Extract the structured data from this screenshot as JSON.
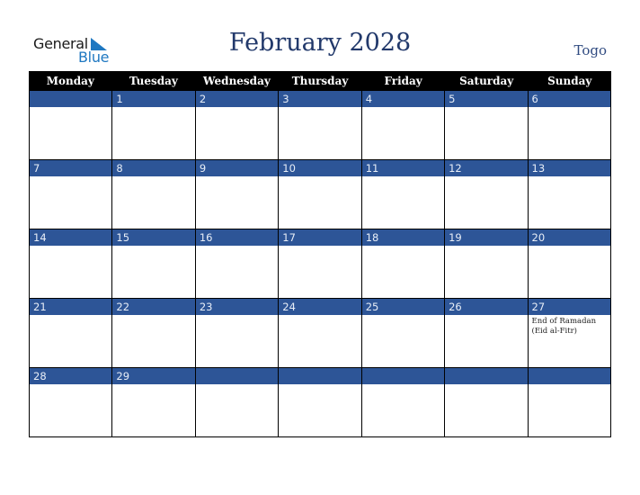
{
  "logo": {
    "line1": "General",
    "line2": "Blue"
  },
  "title": "February 2028",
  "country": "Togo",
  "weekdays": [
    "Monday",
    "Tuesday",
    "Wednesday",
    "Thursday",
    "Friday",
    "Saturday",
    "Sunday"
  ],
  "weeks": [
    [
      {
        "d": ""
      },
      {
        "d": "1"
      },
      {
        "d": "2"
      },
      {
        "d": "3"
      },
      {
        "d": "4"
      },
      {
        "d": "5"
      },
      {
        "d": "6"
      }
    ],
    [
      {
        "d": "7"
      },
      {
        "d": "8"
      },
      {
        "d": "9"
      },
      {
        "d": "10"
      },
      {
        "d": "11"
      },
      {
        "d": "12"
      },
      {
        "d": "13"
      }
    ],
    [
      {
        "d": "14"
      },
      {
        "d": "15"
      },
      {
        "d": "16"
      },
      {
        "d": "17"
      },
      {
        "d": "18"
      },
      {
        "d": "19"
      },
      {
        "d": "20"
      }
    ],
    [
      {
        "d": "21"
      },
      {
        "d": "22"
      },
      {
        "d": "23"
      },
      {
        "d": "24"
      },
      {
        "d": "25"
      },
      {
        "d": "26"
      },
      {
        "d": "27",
        "event": "End of Ramadan (Eid al-Fitr)"
      }
    ],
    [
      {
        "d": "28"
      },
      {
        "d": "29"
      },
      {
        "d": ""
      },
      {
        "d": ""
      },
      {
        "d": ""
      },
      {
        "d": ""
      },
      {
        "d": ""
      }
    ]
  ],
  "colors": {
    "header_bg": "#000000",
    "date_bar": "#2d5597",
    "title": "#22396b",
    "logo_blue": "#1f78c1"
  }
}
